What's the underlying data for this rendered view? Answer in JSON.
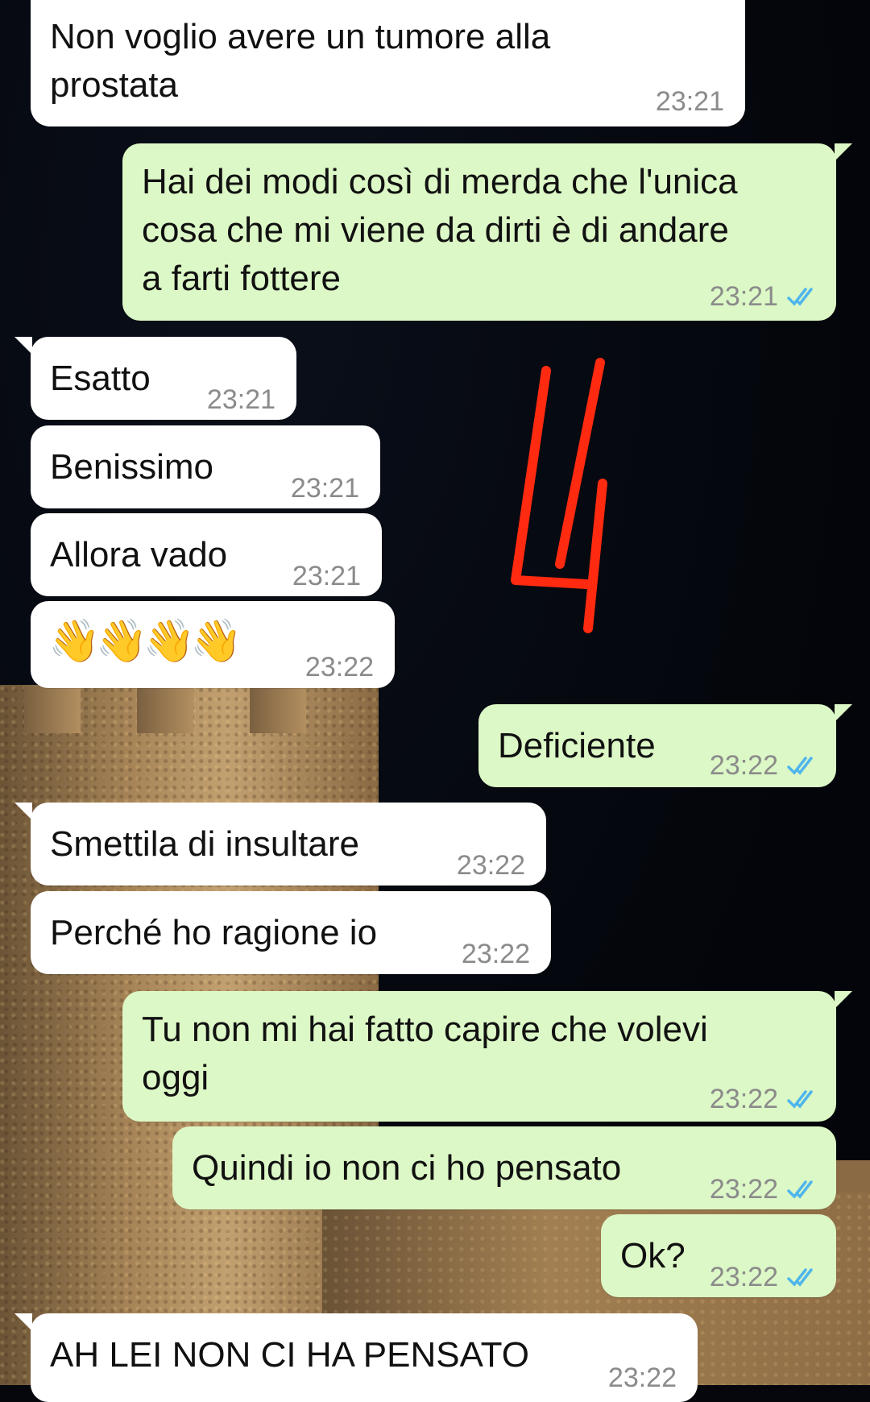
{
  "messages": [
    {
      "dir": "in",
      "text": "Non voglio avere un tumore alla\nprostata",
      "time": "23:21"
    },
    {
      "dir": "out",
      "text": "Hai dei modi così di merda che l'unica\ncosa che mi viene da dirti è di andare\na farti fottere",
      "time": "23:21"
    },
    {
      "dir": "in",
      "text": "Esatto",
      "time": "23:21"
    },
    {
      "dir": "in",
      "text": "Benissimo",
      "time": "23:21"
    },
    {
      "dir": "in",
      "text": "Allora vado",
      "time": "23:21"
    },
    {
      "dir": "in",
      "text": "👋👋👋👋",
      "time": "23:22"
    },
    {
      "dir": "out",
      "text": "Deficiente",
      "time": "23:22"
    },
    {
      "dir": "in",
      "text": "Smettila di insultare",
      "time": "23:22"
    },
    {
      "dir": "in",
      "text": "Perché ho ragione io",
      "time": "23:22"
    },
    {
      "dir": "out",
      "text": "Tu non mi hai fatto capire che volevi\noggi",
      "time": "23:22"
    },
    {
      "dir": "out",
      "text": "Quindi io non ci ho pensato",
      "time": "23:22"
    },
    {
      "dir": "out",
      "text": "Ok?",
      "time": "23:22"
    },
    {
      "dir": "in",
      "text": "AH LEI NON CI HA PENSATO",
      "time": "23:22"
    }
  ],
  "colors": {
    "incoming_bubble": "#ffffff",
    "outgoing_bubble": "#dcf8c6",
    "read_tick": "#4fb6ec",
    "annotation": "#ff2a10"
  },
  "icons": {
    "read_receipt": "double-check-icon",
    "annotation": "hand-drawn-red-4"
  }
}
